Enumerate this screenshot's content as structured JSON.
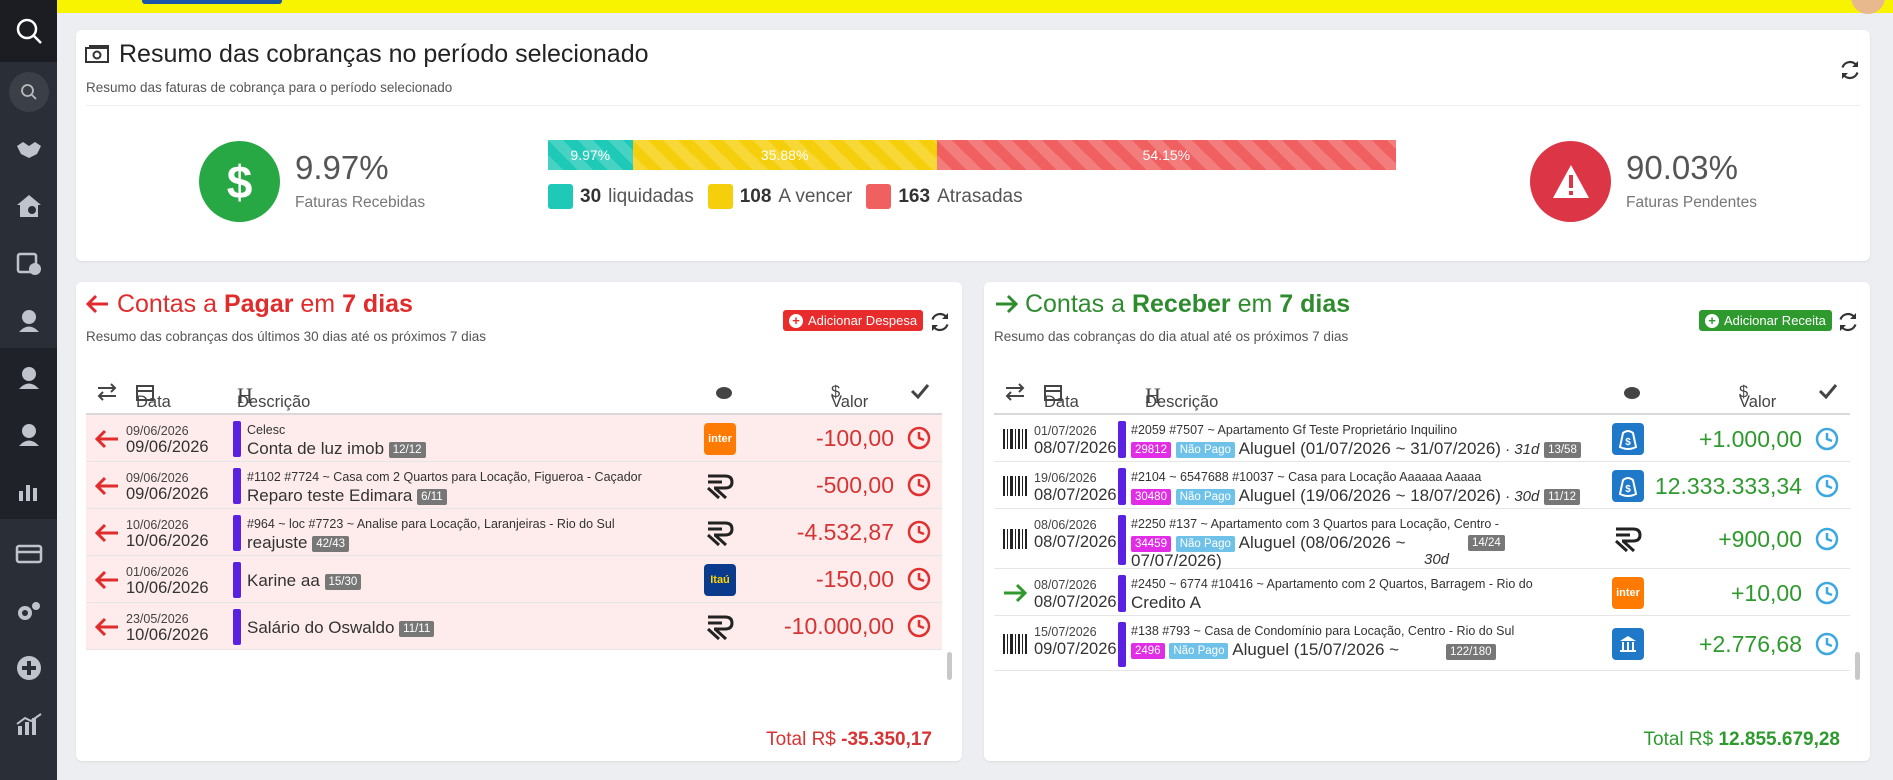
{
  "colors": {
    "green": "#28a745",
    "red": "#e02c2c",
    "red_dark": "#dc3545",
    "teal": "#1fc9b7",
    "yellow": "#f5cf0b",
    "salmon": "#f06060",
    "purple": "#5b21e0",
    "text_red": "#d63434",
    "text_green": "#2e9a2e",
    "clock_red": "#e03030",
    "clock_blue": "#3da8e0"
  },
  "summary": {
    "title": "Resumo das cobranças no período selecionado",
    "subtitle": "Resumo das faturas de cobrança para o período selecionado",
    "received_pct": "9.97%",
    "received_label": "Faturas Recebidas",
    "pending_pct": "90.03%",
    "pending_label": "Faturas Pendentes",
    "bar": [
      {
        "label": "9.97%",
        "value": 9.97
      },
      {
        "label": "35.88%",
        "value": 35.88
      },
      {
        "label": "54.15%",
        "value": 54.15
      }
    ],
    "legend": [
      {
        "count": "30",
        "label": "liquidadas"
      },
      {
        "count": "108",
        "label": "A vencer"
      },
      {
        "count": "163",
        "label": "Atrasadas"
      }
    ]
  },
  "pay": {
    "title_a": "Contas a ",
    "title_b": "Pagar",
    "title_c": " em ",
    "title_d": "7 dias",
    "subtitle": "Resumo das cobranças dos últimos 30 dias até os próximos 7 dias",
    "add_label": "Adicionar Despesa",
    "cols": {
      "date": "Data",
      "desc": "Descrição",
      "value": "Valor"
    },
    "rows": [
      {
        "d1": "09/06/2026",
        "d2": "09/06/2026",
        "meta": "Celesc",
        "desc": "Conta de luz imob",
        "badge": "12/12",
        "bank": "inter",
        "value": "-100,00"
      },
      {
        "d1": "09/06/2026",
        "d2": "09/06/2026",
        "meta": "#1102  #7724 ~ Casa com 2 Quartos para Locação, Figueroa - Caçador",
        "desc": "Reparo teste Edimara",
        "badge": "6/11",
        "bank": "r",
        "value": "-500,00"
      },
      {
        "d1": "10/06/2026",
        "d2": "10/06/2026",
        "meta": "#964 ~ loc  #7723 ~ Analise para Locação, Laranjeiras - Rio do Sul",
        "desc": "reajuste",
        "badge": "42/43",
        "bank": "r",
        "value": "-4.532,87"
      },
      {
        "d1": "01/06/2026",
        "d2": "10/06/2026",
        "meta": "",
        "desc": "Karine aa",
        "badge": "15/30",
        "bank": "itau",
        "value": "-150,00"
      },
      {
        "d1": "23/05/2026",
        "d2": "10/06/2026",
        "meta": "",
        "desc": "Salário do Oswaldo",
        "badge": "11/11",
        "bank": "r",
        "value": "-10.000,00"
      }
    ],
    "total_label": "Total R$ ",
    "total_value": "-35.350,17"
  },
  "rec": {
    "title_a": "Contas a ",
    "title_b": "Receber",
    "title_c": " em ",
    "title_d": "7 dias",
    "subtitle": "Resumo das cobranças do dia atual até os próximos 7 dias",
    "add_label": "Adicionar Receita",
    "cols": {
      "date": "Data",
      "desc": "Descrição",
      "value": "Valor"
    },
    "rows": [
      {
        "d1": "01/07/2026",
        "d2": "08/07/2026",
        "meta": "#2059  #7507 ~ Apartamento  Gf Teste  Proprietário  Inquilino",
        "id": "29812",
        "status": "Não Pago",
        "desc": "Aluguel (01/07/2026 ~ 31/07/2026)",
        "days": " · 31d",
        "badge": "13/58",
        "bank": "money",
        "value": "+1.000,00"
      },
      {
        "d1": "19/06/2026",
        "d2": "08/07/2026",
        "meta": "#2104 ~ 6547688  #10037 ~ Casa para Locação  Aaaaaa Aaaaa",
        "id": "30480",
        "status": "Não Pago",
        "desc": "Aluguel (19/06/2026 ~ 18/07/2026)",
        "days": " · 30d",
        "badge": "11/12",
        "bank": "money",
        "value": "12.333.333,34"
      },
      {
        "d1": "08/06/2026",
        "d2": "08/07/2026",
        "meta": "#2250  #137 ~ Apartamento com 3 Quartos para Locação, Centro -",
        "id": "34459",
        "status": "Não Pago",
        "desc": "Aluguel (08/06/2026 ~",
        "desc2": "07/07/2026)",
        "days": "30d",
        "badge": "14/24",
        "bank": "r",
        "value": "+900,00"
      },
      {
        "d1": "08/07/2026",
        "d2": "08/07/2026",
        "meta": "#2450 ~ 6774  #10416 ~ Apartamento com 2 Quartos, Barragem - Rio do",
        "desc": "Credito A",
        "bank": "inter",
        "value": "+10,00"
      },
      {
        "d1": "15/07/2026",
        "d2": "09/07/2026",
        "meta": "#138  #793 ~ Casa de Condomínio para Locação, Centro - Rio do Sul",
        "id": "2496",
        "status": "Não Pago",
        "desc": "Aluguel (15/07/2026 ~",
        "badge": "122/180",
        "bank": "bank",
        "value": "+2.776,68"
      }
    ],
    "total_label": "Total R$ ",
    "total_value": "12.855.679,28"
  }
}
